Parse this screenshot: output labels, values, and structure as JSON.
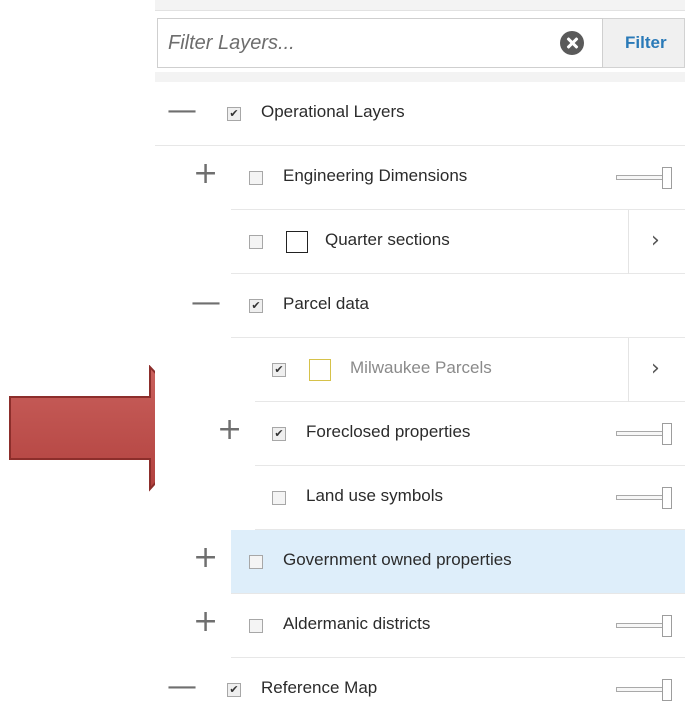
{
  "filter": {
    "placeholder": "Filter Layers...",
    "value": "",
    "button_label": "Filter"
  },
  "toggle_symbols": {
    "collapse": "—",
    "expand": "+"
  },
  "rows": [
    {
      "label": "Operational Layers",
      "toggle": "collapse",
      "checked": true
    },
    {
      "label": "Engineering Dimensions",
      "toggle": "expand",
      "checked": false
    },
    {
      "label": "Quarter sections",
      "checked": false,
      "swatch": "black"
    },
    {
      "label": "Parcel data",
      "toggle": "collapse",
      "checked": true
    },
    {
      "label": "Milwaukee Parcels",
      "checked": true,
      "swatch": "yellow",
      "dimmed": true
    },
    {
      "label": "Foreclosed properties",
      "toggle": "expand",
      "checked": true
    },
    {
      "label": "Land use symbols",
      "checked": false
    },
    {
      "label": "Government owned properties",
      "toggle": "expand",
      "checked": false,
      "highlighted": true
    },
    {
      "label": "Aldermanic districts",
      "toggle": "expand",
      "checked": false
    },
    {
      "label": "Reference Map",
      "toggle": "collapse",
      "checked": true
    }
  ],
  "colors": {
    "annotation_arrow_fill": "#c0504d",
    "annotation_arrow_stroke": "#8c2e2b",
    "highlight_row": "#deeefa",
    "filter_button_text": "#2a7ab8",
    "yellow_swatch": "#d6c24a"
  },
  "icons": {
    "clear_filter": "clear-icon",
    "more_arrow": "chevron-right-icon",
    "annotation": "red-arrow-annotation"
  },
  "arrow_glyph": "›",
  "check_glyph": "✔"
}
